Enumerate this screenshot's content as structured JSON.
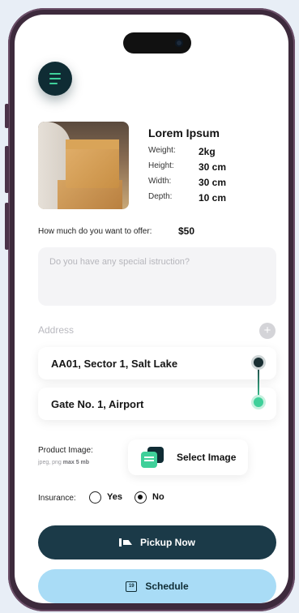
{
  "product": {
    "name": "Lorem Ipsum",
    "specs": [
      {
        "label": "Weight:",
        "value": "2kg"
      },
      {
        "label": "Height:",
        "value": "30 cm"
      },
      {
        "label": "Width:",
        "value": "30 cm"
      },
      {
        "label": "Depth:",
        "value": "10 cm"
      }
    ]
  },
  "offer": {
    "question": "How much do you want to offer:",
    "value": "$50"
  },
  "instruction": {
    "placeholder": "Do you have any special istruction?"
  },
  "address": {
    "label": "Address",
    "add_symbol": "+",
    "pickup": "AA01, Sector 1, Salt Lake",
    "drop": "Gate No. 1, Airport"
  },
  "product_image": {
    "label": "Product Image:",
    "hint_prefix": "jpeg, png",
    "hint_max": "max 5 mb",
    "button_label": "Select Image"
  },
  "insurance": {
    "label": "Insurance:",
    "options": [
      "Yes",
      "No"
    ],
    "selected": "No"
  },
  "actions": {
    "pickup_label": "Pickup Now",
    "schedule_label": "Schedule",
    "calendar_day": "19"
  },
  "colors": {
    "accent_green": "#3fd09a",
    "dark_teal": "#0f2c34",
    "primary_button": "#1b3a48",
    "secondary_button": "#a9dcf6"
  },
  "icons": {
    "menu": "menu-icon",
    "add": "plus-icon",
    "image": "image-icon",
    "pickup": "truck-icon",
    "schedule": "calendar-icon"
  }
}
